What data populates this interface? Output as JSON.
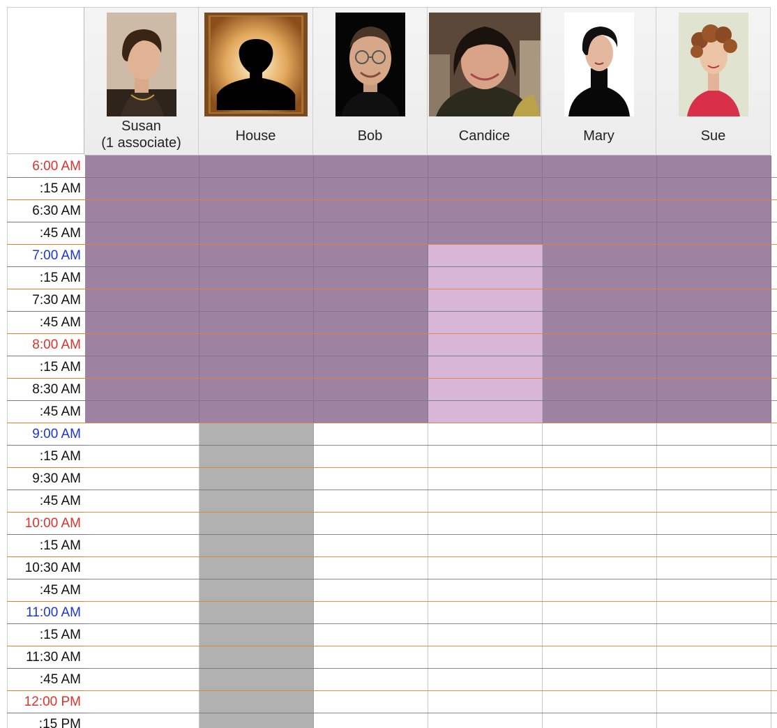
{
  "colors": {
    "hour_red": "#e0322a",
    "hour_blue": "#1a36d6",
    "minute_text": "#111111",
    "busy": "#9e82a2",
    "light_busy": "#d8b6d8",
    "house_block": "#b1b1b1",
    "free": "#ffffff",
    "line_half": "#e8812c",
    "line_quarter": "#7a7a7a"
  },
  "staff": [
    {
      "name": "Susan",
      "subtitle": "(1 associate)",
      "photo_icon": "woman-portrait-short-hair"
    },
    {
      "name": "House",
      "subtitle": "",
      "photo_icon": "silhouette-placeholder"
    },
    {
      "name": "Bob",
      "subtitle": "",
      "photo_icon": "man-portrait-glasses"
    },
    {
      "name": "Candice",
      "subtitle": "",
      "photo_icon": "woman-portrait-dark-hair"
    },
    {
      "name": "Mary",
      "subtitle": "",
      "photo_icon": "woman-portrait-black-turtleneck"
    },
    {
      "name": "Sue",
      "subtitle": "",
      "photo_icon": "woman-portrait-curly-hair"
    }
  ],
  "time_slots": [
    {
      "label": "6:00 AM",
      "kind": "hour-red"
    },
    {
      "label": ":15 AM",
      "kind": "quarter"
    },
    {
      "label": "6:30 AM",
      "kind": "half"
    },
    {
      "label": ":45 AM",
      "kind": "quarter"
    },
    {
      "label": "7:00 AM",
      "kind": "hour-blue"
    },
    {
      "label": ":15 AM",
      "kind": "quarter"
    },
    {
      "label": "7:30 AM",
      "kind": "half"
    },
    {
      "label": ":45 AM",
      "kind": "quarter"
    },
    {
      "label": "8:00 AM",
      "kind": "hour-red"
    },
    {
      "label": ":15 AM",
      "kind": "quarter"
    },
    {
      "label": "8:30 AM",
      "kind": "half"
    },
    {
      "label": ":45 AM",
      "kind": "quarter"
    },
    {
      "label": "9:00 AM",
      "kind": "hour-blue"
    },
    {
      "label": ":15 AM",
      "kind": "quarter"
    },
    {
      "label": "9:30 AM",
      "kind": "half"
    },
    {
      "label": ":45 AM",
      "kind": "quarter"
    },
    {
      "label": "10:00 AM",
      "kind": "hour-red"
    },
    {
      "label": ":15 AM",
      "kind": "quarter"
    },
    {
      "label": "10:30 AM",
      "kind": "half"
    },
    {
      "label": ":45 AM",
      "kind": "quarter"
    },
    {
      "label": "11:00 AM",
      "kind": "hour-blue"
    },
    {
      "label": ":15 AM",
      "kind": "quarter"
    },
    {
      "label": "11:30 AM",
      "kind": "half"
    },
    {
      "label": ":45 AM",
      "kind": "quarter"
    },
    {
      "label": "12:00 PM",
      "kind": "hour-red"
    },
    {
      "label": ":15 PM",
      "kind": "quarter"
    }
  ],
  "availability": [
    [
      "busy",
      "busy",
      "busy",
      "busy",
      "busy",
      "busy",
      "busy",
      "busy",
      "busy",
      "busy",
      "busy",
      "busy",
      "free",
      "free",
      "free",
      "free",
      "free",
      "free",
      "free",
      "free",
      "free",
      "free",
      "free",
      "free",
      "free",
      "free"
    ],
    [
      "busy",
      "busy",
      "busy",
      "busy",
      "busy",
      "busy",
      "busy",
      "busy",
      "busy",
      "busy",
      "busy",
      "busy",
      "blocked",
      "blocked",
      "blocked",
      "blocked",
      "blocked",
      "blocked",
      "blocked",
      "blocked",
      "blocked",
      "blocked",
      "blocked",
      "blocked",
      "blocked",
      "blocked"
    ],
    [
      "busy",
      "busy",
      "busy",
      "busy",
      "busy",
      "busy",
      "busy",
      "busy",
      "busy",
      "busy",
      "busy",
      "busy",
      "free",
      "free",
      "free",
      "free",
      "free",
      "free",
      "free",
      "free",
      "free",
      "free",
      "free",
      "free",
      "free",
      "free"
    ],
    [
      "busy",
      "busy",
      "busy",
      "busy",
      "light",
      "light",
      "light",
      "light",
      "light",
      "light",
      "light",
      "light",
      "free",
      "free",
      "free",
      "free",
      "free",
      "free",
      "free",
      "free",
      "free",
      "free",
      "free",
      "free",
      "free",
      "free"
    ],
    [
      "busy",
      "busy",
      "busy",
      "busy",
      "busy",
      "busy",
      "busy",
      "busy",
      "busy",
      "busy",
      "busy",
      "busy",
      "free",
      "free",
      "free",
      "free",
      "free",
      "free",
      "free",
      "free",
      "free",
      "free",
      "free",
      "free",
      "free",
      "free"
    ],
    [
      "busy",
      "busy",
      "busy",
      "busy",
      "busy",
      "busy",
      "busy",
      "busy",
      "busy",
      "busy",
      "busy",
      "busy",
      "free",
      "free",
      "free",
      "free",
      "free",
      "free",
      "free",
      "free",
      "free",
      "free",
      "free",
      "free",
      "free",
      "free"
    ]
  ]
}
